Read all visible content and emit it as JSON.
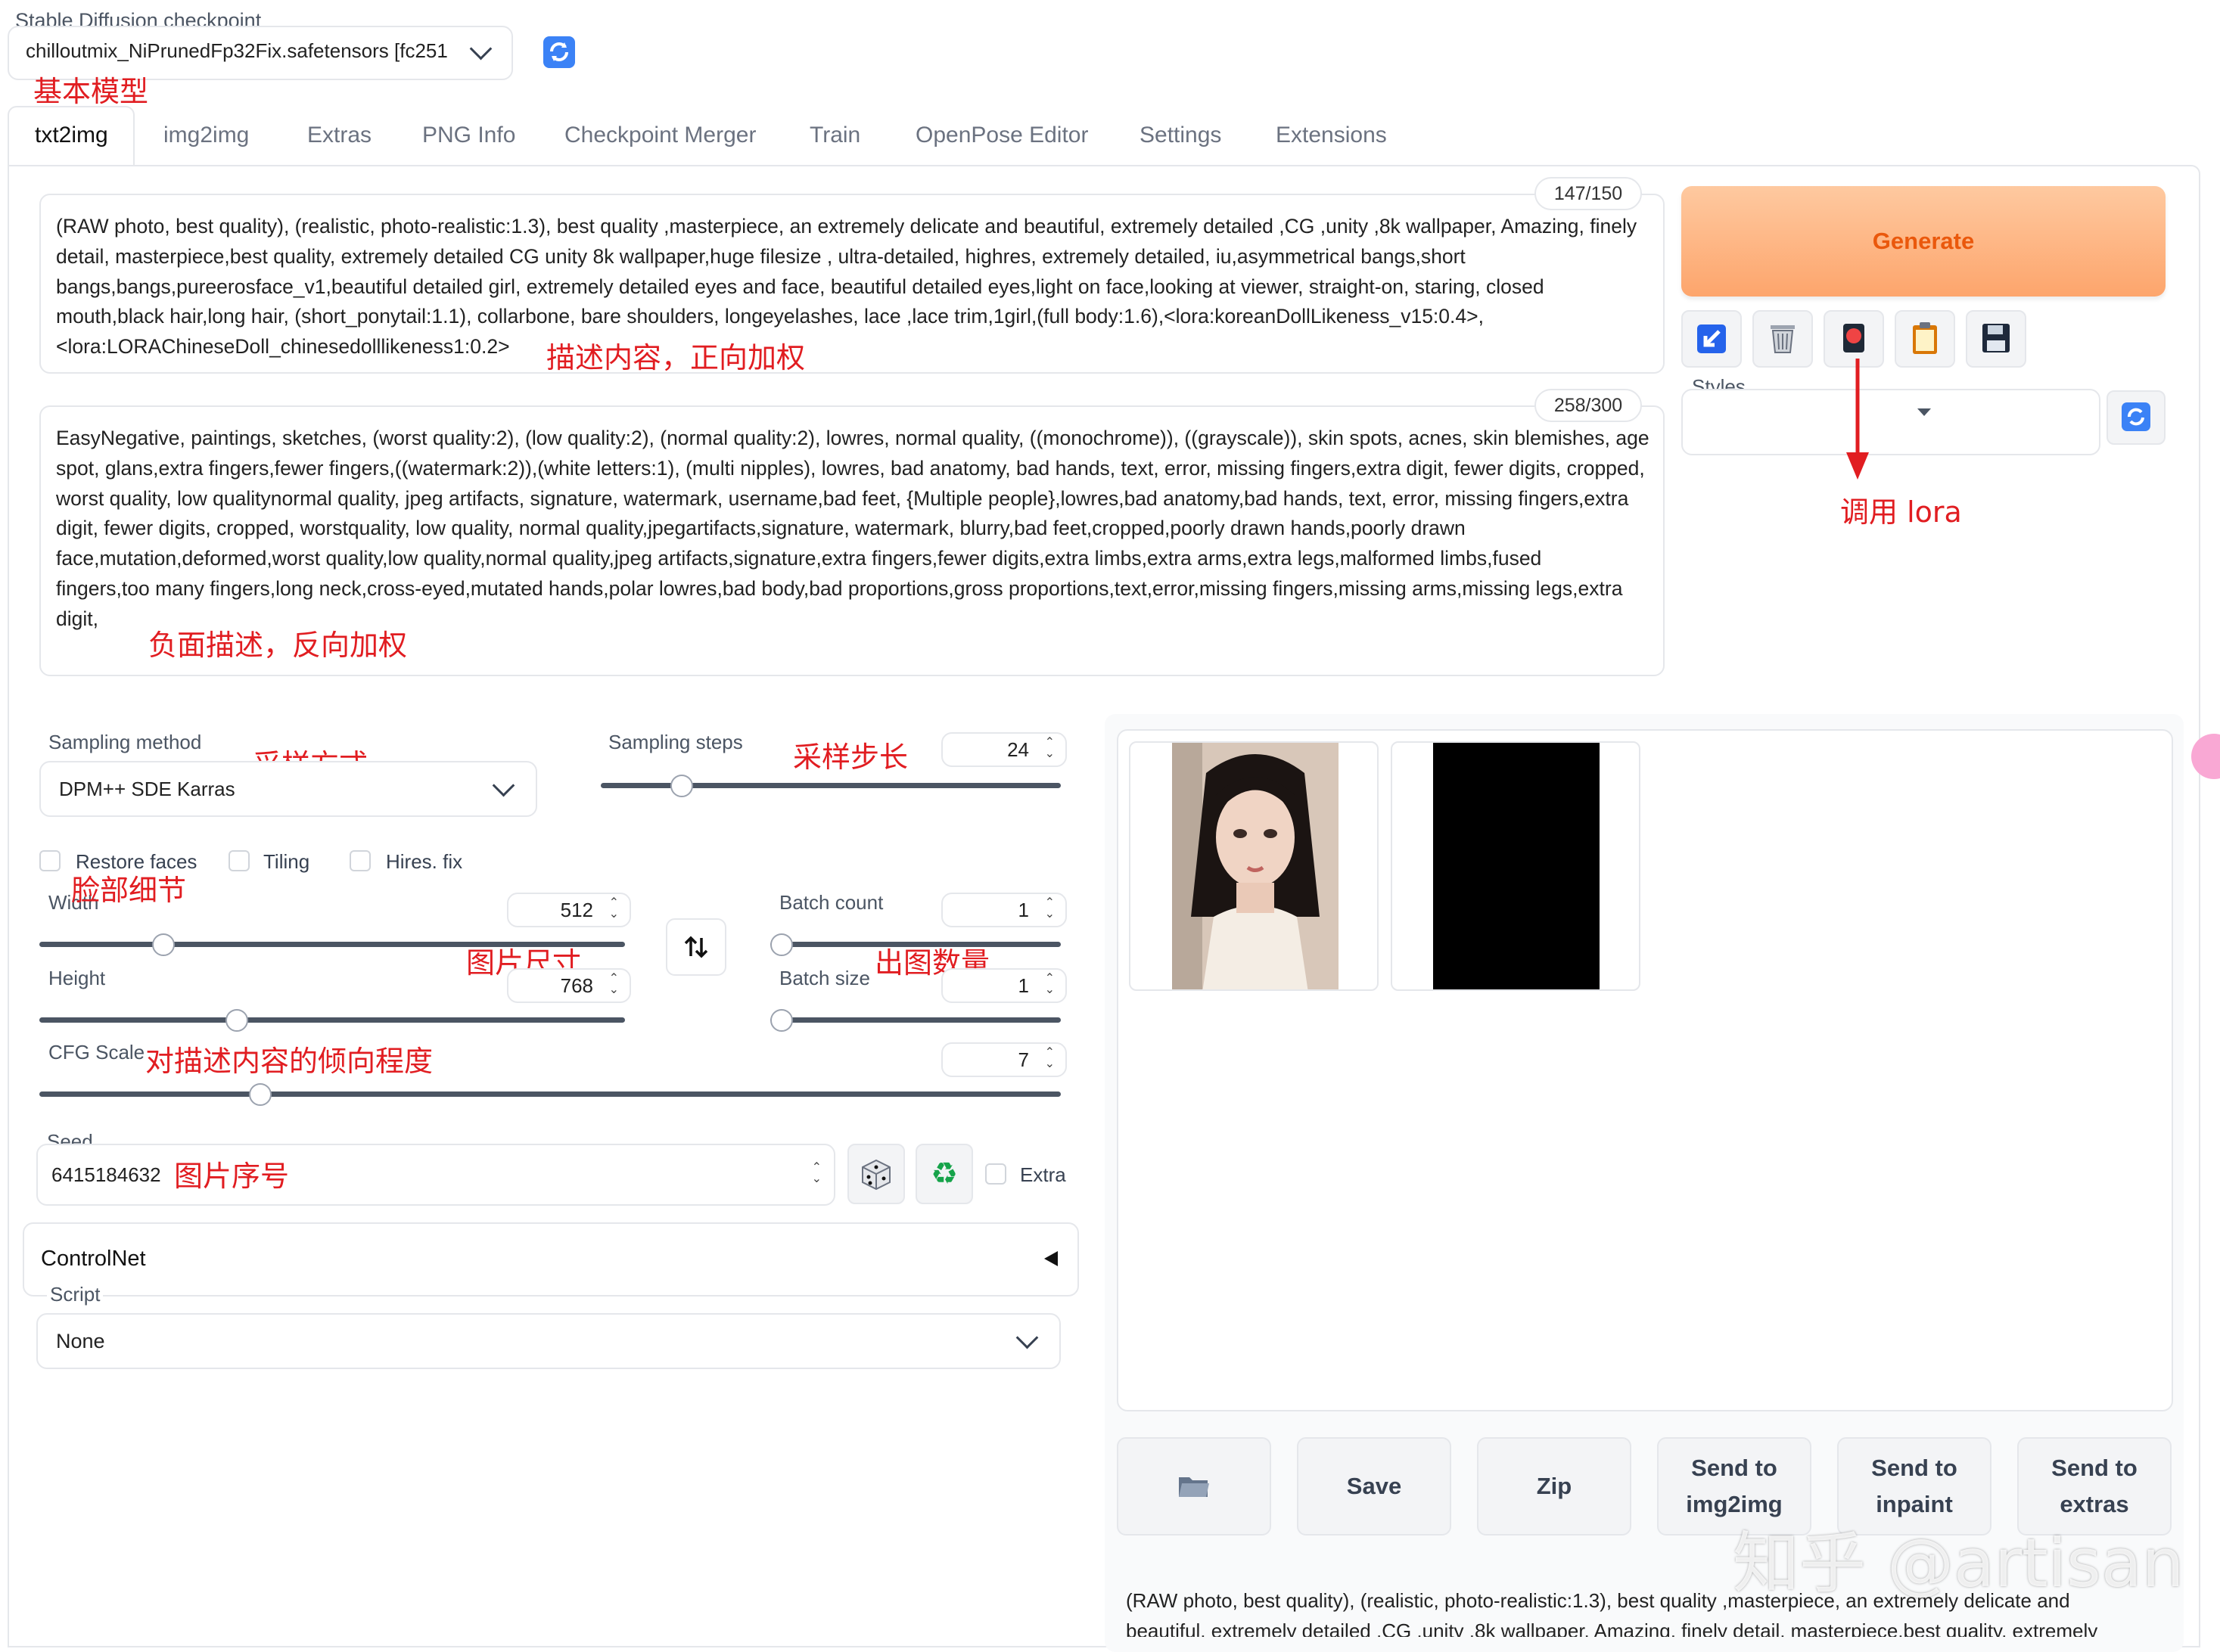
{
  "checkpoint": {
    "label": "Stable Diffusion checkpoint",
    "value": "chilloutmix_NiPrunedFp32Fix.safetensors [fc251"
  },
  "tabs": [
    "txt2img",
    "img2img",
    "Extras",
    "PNG Info",
    "Checkpoint Merger",
    "Train",
    "OpenPose Editor",
    "Settings",
    "Extensions"
  ],
  "active_tab": "txt2img",
  "prompt": {
    "counter": "147/150",
    "text": "(RAW photo, best quality), (realistic, photo-realistic:1.3), best quality ,masterpiece, an extremely delicate and beautiful, extremely detailed ,CG ,unity ,8k wallpaper, Amazing, finely\ndetail, masterpiece,best quality, extremely detailed CG unity 8k wallpaper,huge filesize , ultra-detailed, highres, extremely detailed, iu,asymmetrical bangs,short\nbangs,bangs,pureerosface_v1,beautiful detailed girl, extremely detailed eyes and face, beautiful detailed eyes,light on face,looking at viewer, straight-on, staring, closed\nmouth,black hair,long hair, (short_ponytail:1.1), collarbone, bare shoulders, longeyelashes, lace ,lace trim,1girl,(full body:1.6),<lora:koreanDollLikeness_v15:0.4>,\n<lora:LORAChineseDoll_chinesedolllikeness1:0.2>"
  },
  "negative_prompt": {
    "counter": "258/300",
    "text": "EasyNegative, paintings, sketches, (worst quality:2), (low quality:2), (normal quality:2), lowres, normal quality, ((monochrome)), ((grayscale)), skin spots, acnes, skin blemishes, age\nspot, glans,extra fingers,fewer fingers,((watermark:2)),(white letters:1), (multi nipples), lowres, bad anatomy, bad hands, text, error, missing fingers,extra digit, fewer digits, cropped,\nworst quality, low qualitynormal quality, jpeg artifacts, signature, watermark, username,bad feet, {Multiple people},lowres,bad anatomy,bad hands, text, error, missing fingers,extra\ndigit, fewer digits, cropped, worstquality, low quality, normal quality,jpegartifacts,signature, watermark, blurry,bad feet,cropped,poorly drawn hands,poorly drawn\nface,mutation,deformed,worst quality,low quality,normal quality,jpeg artifacts,signature,extra fingers,fewer digits,extra limbs,extra arms,extra legs,malformed limbs,fused\nfingers,too many fingers,long neck,cross-eyed,mutated hands,polar lowres,bad body,bad proportions,gross proportions,text,error,missing fingers,missing arms,missing legs,extra\ndigit,"
  },
  "generate_label": "Generate",
  "styles_label": "Styles",
  "tool_icons": [
    "arrow-down-left-icon",
    "trash-icon",
    "red-card-icon",
    "clipboard-icon",
    "floppy-disk-icon"
  ],
  "sampling": {
    "method_label": "Sampling method",
    "method_value": "DPM++ SDE Karras",
    "steps_label": "Sampling steps",
    "steps_value": "24",
    "steps_fraction": 0.16
  },
  "options": {
    "restore_faces": "Restore faces",
    "tiling": "Tiling",
    "hires_fix": "Hires. fix"
  },
  "width": {
    "label": "Width",
    "value": "512",
    "fraction": 0.2
  },
  "height": {
    "label": "Height",
    "value": "768",
    "fraction": 0.33
  },
  "batch_count": {
    "label": "Batch count",
    "value": "1",
    "fraction": 0.0
  },
  "batch_size": {
    "label": "Batch size",
    "value": "1",
    "fraction": 0.0
  },
  "cfg": {
    "label": "CFG Scale",
    "value": "7",
    "fraction": 0.21
  },
  "seed": {
    "label": "Seed",
    "value": "6415184632",
    "extra_label": "Extra"
  },
  "controlnet_label": "ControlNet",
  "script": {
    "label": "Script",
    "value": "None"
  },
  "output_buttons": {
    "folder": "folder-icon",
    "save": "Save",
    "zip": "Zip",
    "send_img2img": "Send to\nimg2img",
    "send_inpaint": "Send to\ninpaint",
    "send_extras": "Send to\nextras"
  },
  "output_info": "(RAW photo, best quality), (realistic, photo-realistic:1.3), best quality ,masterpiece, an extremely delicate and\nbeautiful, extremely detailed ,CG ,unity ,8k wallpaper, Amazing, finely detail, masterpiece,best quality, extremely",
  "annotations": {
    "base_model": "基本模型",
    "prompt_note": "描述内容，正向加权",
    "negative_note": "负面描述，反向加权",
    "lora_note": "调用 lora",
    "sampling_method_note": "采样方式",
    "sampling_steps_note": "采样步长",
    "restore_note": "脸部细节",
    "size_note": "图片尺寸",
    "batch_note": "出图数量",
    "cfg_note": "对描述内容的倾向程度",
    "seed_note": "图片序号"
  },
  "watermark": "知乎 @artisan",
  "colors": {
    "generate_bg": "#fdb07e",
    "generate_text": "#ea580c",
    "annotation": "#e11d21",
    "refresh_icon": "#3b82f6"
  }
}
